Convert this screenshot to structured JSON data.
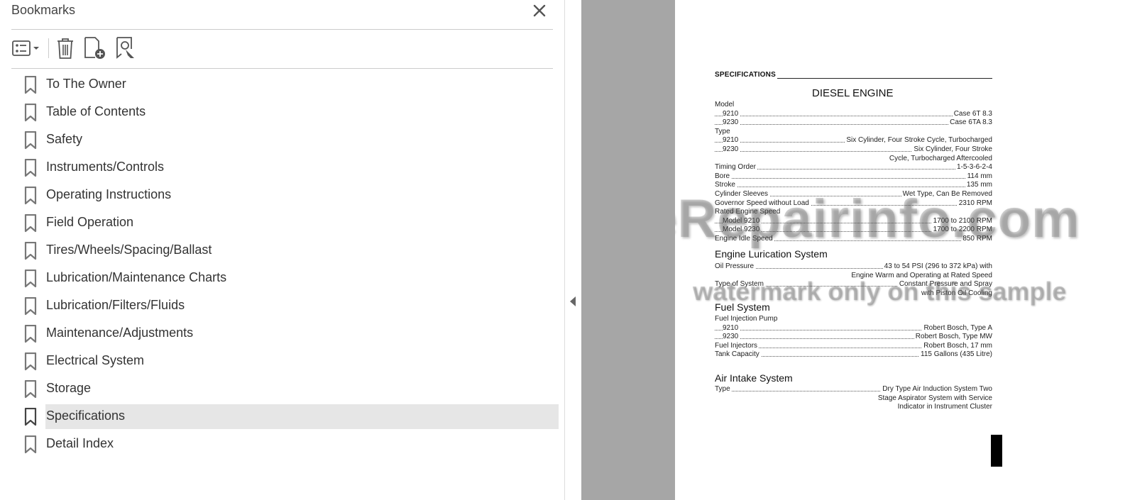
{
  "panel": {
    "title": "Bookmarks",
    "bookmarks": [
      {
        "label": "To The Owner"
      },
      {
        "label": "Table of Contents"
      },
      {
        "label": "Safety"
      },
      {
        "label": "Instruments/Controls"
      },
      {
        "label": "Operating Instructions"
      },
      {
        "label": "Field Operation"
      },
      {
        "label": "Tires/Wheels/Spacing/Ballast"
      },
      {
        "label": "Lubrication/Maintenance Charts"
      },
      {
        "label": "Lubrication/Filters/Fluids"
      },
      {
        "label": "Maintenance/Adjustments"
      },
      {
        "label": "Electrical System"
      },
      {
        "label": "Storage"
      },
      {
        "label": "Specifications",
        "selected": true
      },
      {
        "label": "Detail Index"
      }
    ]
  },
  "document": {
    "section_header": "SPECIFICATIONS",
    "title": "DIESEL ENGINE",
    "engine": {
      "model_label": "Model",
      "model_9210": {
        "label": "9210",
        "value": "Case 6T 8.3"
      },
      "model_9230": {
        "label": "9230",
        "value": "Case 6TA 8.3"
      },
      "type_label": "Type",
      "type_9210": {
        "label": "9210",
        "value": "Six Cylinder, Four Stroke Cycle, Turbocharged"
      },
      "type_9230": {
        "label": "9230",
        "value": "Six Cylinder, Four Stroke"
      },
      "type_9230_cont": "Cycle, Turbocharged Aftercooled",
      "timing": {
        "label": "Timing Order",
        "value": "1-5-3-6-2-4"
      },
      "bore": {
        "label": "Bore",
        "value": "114 mm"
      },
      "stroke": {
        "label": "Stroke",
        "value": "135 mm"
      },
      "sleeves": {
        "label": "Cylinder Sleeves",
        "value": "Wet Type, Can Be Removed"
      },
      "governor": {
        "label": "Governor Speed without Load",
        "value": "2310 RPM"
      },
      "rated_label": "Rated Engine Speed",
      "rated_9210": {
        "label": "Model 9210",
        "value": "1700 to 2100 RPM"
      },
      "rated_9230": {
        "label": "Model 9230",
        "value": "1700 to 2200 RPM"
      },
      "idle": {
        "label": "Engine Idle Speed",
        "value": "850 RPM"
      }
    },
    "lube": {
      "heading": "Engine Lurication System",
      "oil": {
        "label": "Oil Pressure",
        "value": "43 to 54 PSI (296 to 372 kPa) with"
      },
      "oil_cont": "Engine Warm and Operating at Rated Speed",
      "system": {
        "label": "Type of System",
        "value": "Constant Pressure and Spray"
      },
      "system_cont": "with Piston Oil Cooling"
    },
    "fuel": {
      "heading": "Fuel System",
      "pump_label": "Fuel Injection Pump",
      "pump_9210": {
        "label": "9210",
        "value": "Robert Bosch, Type A"
      },
      "pump_9230": {
        "label": "9230",
        "value": "Robert Bosch, Type MW"
      },
      "injectors": {
        "label": "Fuel Injectors",
        "value": "Robert Bosch, 17 mm"
      },
      "tank": {
        "label": "Tank Capacity",
        "value": "115 Gallons (435 Litre)"
      }
    },
    "air": {
      "heading": "Air Intake System",
      "type": {
        "label": "Type",
        "value": "Dry Type Air Induction System Two"
      },
      "type_cont1": "Stage Aspirator System with Service",
      "type_cont2": "Indicator in Instrument Cluster"
    },
    "watermark_main": "eRepairinfo.com",
    "watermark_sub": "watermark only on this sample"
  }
}
